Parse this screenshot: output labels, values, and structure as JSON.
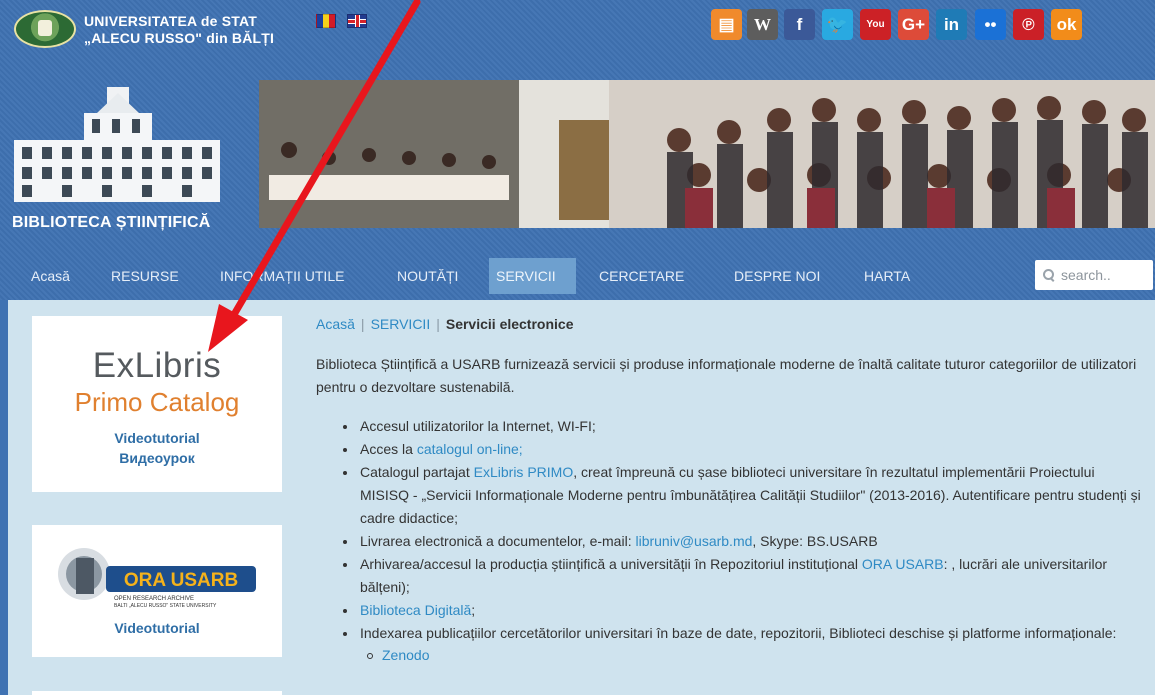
{
  "colors": {
    "header_blue": "#3f72b2",
    "link": "#2f8ac4",
    "arrow": "#e8161d",
    "active_nav": "#6ea0cf",
    "content_bg": "#cfe3ee"
  },
  "university": {
    "line1": "UNIVERSITATEA de STAT",
    "line2": "„ALECU RUSSO\" din BĂLȚI"
  },
  "languages": [
    "ro-flag",
    "uk-flag"
  ],
  "social": [
    {
      "icon": "book-icon",
      "glyph": "▤",
      "color": "#f08a2c"
    },
    {
      "icon": "wikipedia-icon",
      "glyph": "W",
      "color": "#5d5d5d"
    },
    {
      "icon": "facebook-icon",
      "glyph": "f",
      "color": "#3b5998"
    },
    {
      "icon": "twitter-icon",
      "glyph": "🐦",
      "color": "#29a9e1"
    },
    {
      "icon": "youtube-icon",
      "glyph": "You",
      "color": "#cc2126"
    },
    {
      "icon": "google-plus-icon",
      "glyph": "G+",
      "color": "#dd4b39"
    },
    {
      "icon": "linkedin-icon",
      "glyph": "in",
      "color": "#1f7bb6"
    },
    {
      "icon": "flickr-icon",
      "glyph": "••",
      "color": "#1b71d6"
    },
    {
      "icon": "pinterest-icon",
      "glyph": "℗",
      "color": "#cb2027"
    },
    {
      "icon": "odnoklassniki-icon",
      "glyph": "ok",
      "color": "#f28c1a"
    }
  ],
  "library_title": "BIBLIOTECA ȘTIINȚIFICĂ",
  "nav": [
    "Acasă",
    "RESURSE",
    "INFORMAȚII UTILE",
    "NOUTĂȚI",
    "SERVICII",
    "CERCETARE",
    "DESPRE NOI",
    "HARTA"
  ],
  "nav_active": "SERVICII",
  "search": {
    "placeholder": "search.."
  },
  "sidebar": {
    "exlibris_text": "ExLibris",
    "primo_text": "Primo Catalog",
    "card1_links": [
      "Videotutorial",
      "Видеоурок"
    ],
    "ora_text": "ORA USARB",
    "ora_sub1": "OPEN RESEARCH ARCHIVE",
    "ora_sub2": "BALTI „ALECU RUSSO\" STATE UNIVERSITY",
    "card2_link": "Videotutorial"
  },
  "breadcrumb": {
    "home": "Acasă",
    "section": "SERVICII",
    "current": "Servicii electronice",
    "separator": "|"
  },
  "intro": "Biblioteca Științifică a USARB furnizează servicii și produse informaționale moderne de înaltă calitate tuturor categoriilor de utilizatori pentru o dezvoltare sustenabilă.",
  "services": {
    "item1": "Accesul utilizatorilor la Internet, WI-FI;",
    "item2_pre": "Acces la ",
    "item2_link": "catalogul on-line;",
    "item3_pre": "Catalogul partajat ",
    "item3_link": "ExLibris PRIMO",
    "item3_post": ", creat împreună cu șase biblioteci universitare în rezultatul implementării Proiectului MISISQ - „Servicii Informaționale Moderne pentru îmbunătățirea Calității Studiilor\" (2013-2016). Autentificare pentru studenți și cadre didactice;",
    "item4_pre": "Livrarea electronică a documentelor, e-mail: ",
    "item4_link": "libruniv@usarb.md",
    "item4_post": ", Skype: BS.USARB",
    "item5_pre": "Arhivarea/accesul la producția științifică a universității în Repozitoriul instituțional ",
    "item5_link": "ORA USARB",
    "item5_post": ": , lucrări ale universitarilor bălțeni);",
    "item6_link": "Biblioteca Digitală",
    "item6_post": ";",
    "item7": "Indexarea publicațiilor cercetătorilor universitari în baze de date, repozitorii, Biblioteci deschise și platforme informaționale:",
    "sub1": "Zenodo"
  }
}
